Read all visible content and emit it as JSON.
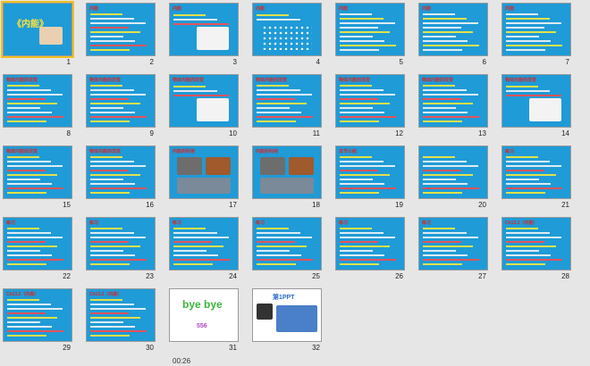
{
  "slides": [
    {
      "number": "1",
      "title": "《内能》",
      "kind": "cover"
    },
    {
      "number": "2",
      "title": "内能",
      "kind": "lines"
    },
    {
      "number": "3",
      "title": "内能",
      "kind": "people"
    },
    {
      "number": "4",
      "title": "内能",
      "kind": "dots"
    },
    {
      "number": "5",
      "title": "内能",
      "kind": "text"
    },
    {
      "number": "6",
      "title": "内能",
      "kind": "text"
    },
    {
      "number": "7",
      "title": "内能",
      "kind": "text"
    },
    {
      "number": "8",
      "title": "物体内能的改变",
      "kind": "lines"
    },
    {
      "number": "9",
      "title": "物体内能的改变",
      "kind": "lines"
    },
    {
      "number": "10",
      "title": "物体内能的改变",
      "kind": "people"
    },
    {
      "number": "11",
      "title": "物体内能的改变",
      "kind": "lines"
    },
    {
      "number": "12",
      "title": "物体内能的改变",
      "kind": "lines"
    },
    {
      "number": "13",
      "title": "物体内能的改变",
      "kind": "lines"
    },
    {
      "number": "14",
      "title": "物体内能的改变",
      "kind": "people"
    },
    {
      "number": "15",
      "title": "物体内能的改变",
      "kind": "lines"
    },
    {
      "number": "16",
      "title": "物体内能的改变",
      "kind": "lines"
    },
    {
      "number": "17",
      "title": "内能的利用",
      "kind": "photos"
    },
    {
      "number": "18",
      "title": "内能的利用",
      "kind": "photos"
    },
    {
      "number": "19",
      "title": "本节小结",
      "kind": "lines"
    },
    {
      "number": "20",
      "title": "",
      "kind": "lines"
    },
    {
      "number": "21",
      "title": "练习",
      "kind": "lines"
    },
    {
      "number": "22",
      "title": "练习",
      "kind": "lines"
    },
    {
      "number": "23",
      "title": "练习",
      "kind": "lines"
    },
    {
      "number": "24",
      "title": "练习",
      "kind": "lines"
    },
    {
      "number": "25",
      "title": "练习",
      "kind": "lines"
    },
    {
      "number": "26",
      "title": "练习",
      "kind": "lines"
    },
    {
      "number": "27",
      "title": "练习",
      "kind": "lines"
    },
    {
      "number": "28",
      "title": "Ch13.2（内能）",
      "kind": "lines"
    },
    {
      "number": "29",
      "title": "Ch13.2（内能）",
      "kind": "lines"
    },
    {
      "number": "30",
      "title": "Ch13.2（内能）",
      "kind": "lines"
    },
    {
      "number": "31",
      "title": "bye bye",
      "kind": "bye"
    },
    {
      "number": "32",
      "title": "第1PPT",
      "kind": "brand"
    }
  ],
  "slide31_sub": "556",
  "timer": "00:26"
}
